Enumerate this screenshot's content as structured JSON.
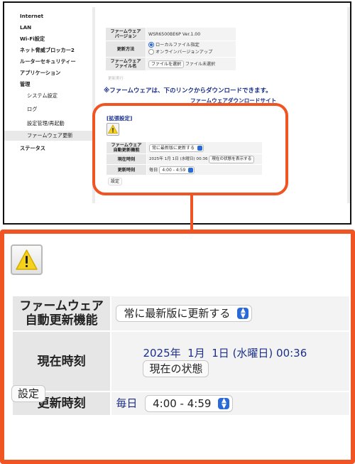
{
  "sidebar": {
    "items": [
      {
        "label": "Internet"
      },
      {
        "label": "LAN"
      },
      {
        "label": "Wi-Fi設定"
      },
      {
        "label": "ネット脅威ブロッカー2"
      },
      {
        "label": "ルーターセキュリティー"
      },
      {
        "label": "アプリケーション"
      },
      {
        "label": "管理"
      },
      {
        "label": "システム設定"
      },
      {
        "label": "ログ"
      },
      {
        "label": "設定管理/再起動"
      },
      {
        "label": "ファームウェア更新"
      },
      {
        "label": "ステータス"
      }
    ],
    "active": "ファームウェア更新"
  },
  "firmware": {
    "version_label": "ファームウェア\nバージョン",
    "version_value": "WSR6500BE6P Ver.1.00",
    "method_label": "更新方法",
    "method_option_local": "ローカルファイル指定",
    "method_option_online": "オンラインバージョンアップ",
    "file_label": "ファームウェア\nファイル名",
    "choose_file_button": "ファイルを選択",
    "no_file_text": "ファイル未選択",
    "update_run": "更新実行",
    "note": "※ファームウェアは、下のリンクからダウンロードできます。",
    "download_link": "ファームウェアダウンロードサイト"
  },
  "advanced": {
    "title": "[拡張設定]",
    "auto_update_label": "ファームウェア\n自動更新機能",
    "auto_update_value": "常に最新版に更新する",
    "current_time_label": "現在時刻",
    "current_time_value": "2025年 1月 1日 (水曜日) 00:36",
    "current_time_value_zoom": "2025年  1月  1日 (水曜日) 00:36",
    "show_state_button": "現在の状態を表示する",
    "show_state_button_zoom": "現在の状態",
    "update_time_label": "更新時刻",
    "update_freq": "毎日",
    "update_window": "4:00 - 4:59",
    "set_button": "設定"
  },
  "colors": {
    "accent_orange": "#f05423",
    "link_navy": "#1b2f8a",
    "select_blue": "#2a6ad8",
    "label_gray": "#e6e6e6"
  },
  "icons": {
    "warning": "warning-icon",
    "select_arrows": "chevron-up-down-icon"
  }
}
